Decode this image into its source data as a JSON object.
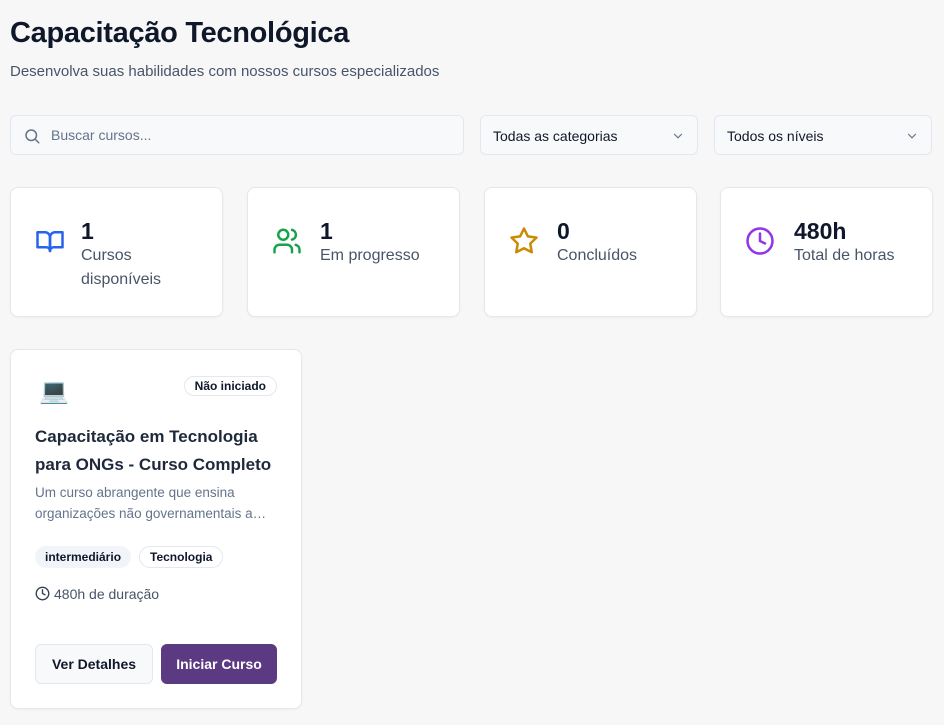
{
  "header": {
    "title": "Capacitação Tecnológica",
    "subtitle": "Desenvolva suas habilidades com nossos cursos especializados"
  },
  "filters": {
    "search_placeholder": "Buscar cursos...",
    "search_value": "",
    "category_selected": "Todas as categorias",
    "level_selected": "Todos os níveis"
  },
  "stats": [
    {
      "value": "1",
      "label": "Cursos disponíveis",
      "icon": "book-icon",
      "color": "#2563eb"
    },
    {
      "value": "1",
      "label": "Em progresso",
      "icon": "users-icon",
      "color": "#16a34a"
    },
    {
      "value": "0",
      "label": "Concluídos",
      "icon": "star-icon",
      "color": "#ca8a04"
    },
    {
      "value": "480h",
      "label": "Total de horas",
      "icon": "clock-icon",
      "color": "#9333ea"
    }
  ],
  "courses": [
    {
      "thumbnail": "💻",
      "status": "Não iniciado",
      "title": "Capacitação em Tecnologia para ONGs - Curso Completo",
      "description": "Um curso abrangente que ensina organizações não governamentais a utilizar tecnologia de forma eficiente",
      "level": "intermediário",
      "category": "Tecnologia",
      "duration": "480h de duração",
      "details_button": "Ver Detalhes",
      "start_button": "Iniciar Curso"
    }
  ],
  "colors": {
    "primary": "#5b3a82",
    "background": "#f7f7f8"
  }
}
